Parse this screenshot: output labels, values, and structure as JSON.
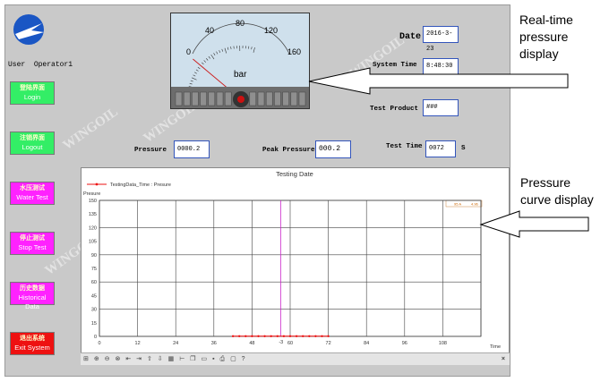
{
  "user": {
    "label": "User",
    "name": "Operator1"
  },
  "watermark": "WINGOIL",
  "buttons": [
    {
      "cn": "登陆界面",
      "en": "Login"
    },
    {
      "cn": "注销界面",
      "en": "Logout"
    },
    {
      "cn": "水压测试",
      "en": "Water Test"
    },
    {
      "cn": "停止测试",
      "en": "Stop Test"
    },
    {
      "cn": "历史数据",
      "en": "Historical Data"
    },
    {
      "cn": "退出系统",
      "en": "Exit System"
    }
  ],
  "gauge": {
    "ticks": [
      "0",
      "40",
      "80",
      "120",
      "160"
    ],
    "unit": "bar",
    "value": 0
  },
  "fields": {
    "date_label": "Date",
    "date_value": "2016-3-23",
    "time_label": "System Time",
    "time_value": "8:48:30",
    "product_label": "Test Product",
    "product_value": "###",
    "test_time_label": "Test Time",
    "test_time_value": "0072",
    "test_time_unit": "S",
    "pressure_label": "Pressure",
    "pressure_value": "0000.2",
    "peak_label": "Peak Pressure",
    "peak_value": "000.2"
  },
  "chart_data": {
    "type": "line",
    "title": "Testing Date",
    "legend": "TestingData_Time : Presure",
    "ylabel": "Presure",
    "xlabel": "Time",
    "ylim": [
      0,
      150
    ],
    "xlim": [
      0,
      120
    ],
    "y_ticks": [
      "150",
      "135",
      "120",
      "105",
      "90",
      "75",
      "60",
      "45",
      "30",
      "15",
      "0"
    ],
    "x_ticks": [
      "0",
      "12",
      "24",
      "36",
      "48",
      "60",
      "72",
      "84",
      "96",
      "108"
    ],
    "cursor_x": 57,
    "cursor_label": "-3",
    "readout": [
      "95 A",
      "4.96"
    ],
    "series": [
      {
        "x": [
          42,
          44,
          46,
          48,
          50,
          52,
          54,
          56,
          58,
          60,
          62,
          64,
          66,
          68,
          70,
          72
        ],
        "y": [
          0.2,
          0.2,
          0.2,
          0.2,
          0.2,
          0.2,
          0.2,
          0.2,
          0.2,
          0.2,
          0.2,
          0.2,
          0.2,
          0.2,
          0.2,
          0.2
        ]
      }
    ],
    "series_color": "#ee1111",
    "grid": true
  },
  "annotations": {
    "realtime": "Real-time\npressure\ndisplay",
    "curve": "Pressure\ncurve display"
  }
}
